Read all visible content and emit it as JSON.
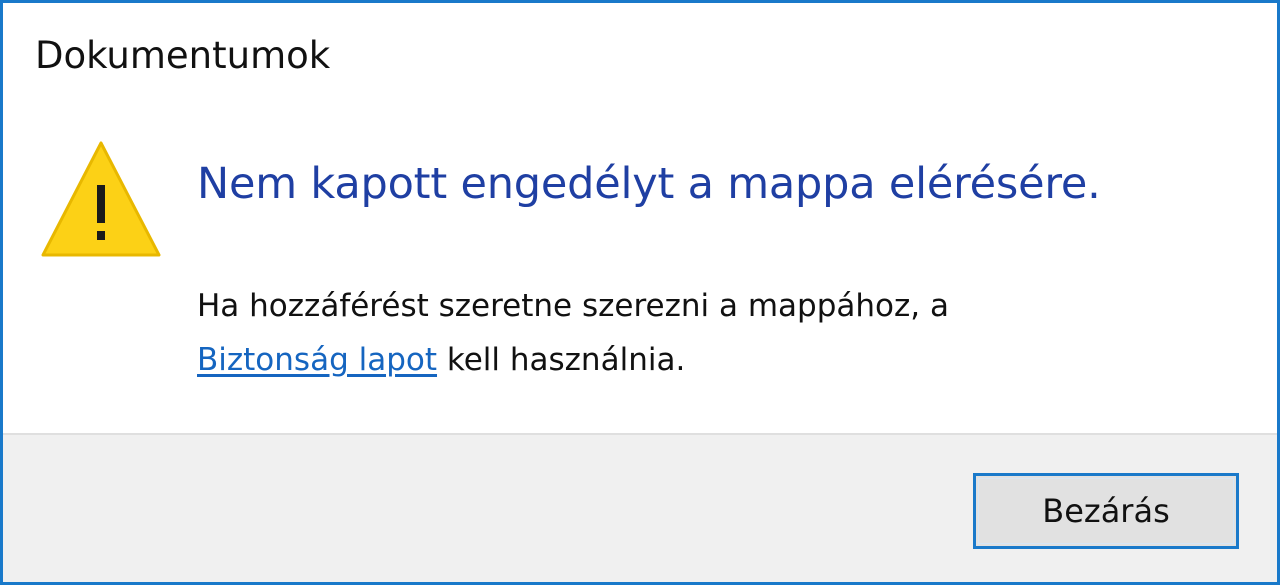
{
  "window": {
    "title": "Dokumentumok"
  },
  "message": {
    "icon": "warning-icon",
    "heading": "Nem kapott engedélyt a mappa elérésére.",
    "body_line1": "Ha hozzáférést szeretne szerezni a mappához, a",
    "link_text": "Biztonság lapot",
    "body_line2_rest": " kell használnia."
  },
  "footer": {
    "close_label": "Bezárás"
  },
  "colors": {
    "accent_border": "#1979ca",
    "heading": "#1f3fa3",
    "link": "#1565c0",
    "warning_fill": "#fcd116",
    "footer_bg": "#f0f0f0"
  }
}
